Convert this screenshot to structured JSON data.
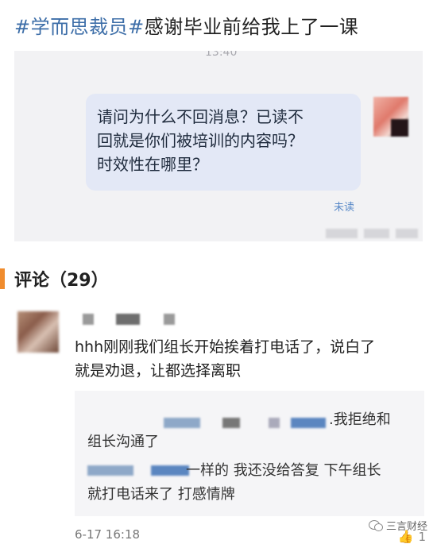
{
  "post": {
    "hashtag1": "#学而思裁员#",
    "title": "感谢毕业前给我上了一课"
  },
  "screenshot": {
    "time": "13:40",
    "message_lines": [
      "请问为什么不回消息？已读不",
      "回就是你们被培训的内容吗？",
      "时效性在哪里？"
    ],
    "status": "未读"
  },
  "comments": {
    "header": "评论（29）",
    "items": [
      {
        "text_lines": [
          "hhh刚刚我们组长开始挨着打电话了，说白了",
          "就是劝退，让都选择离职"
        ],
        "replies": [
          {
            "line1": ".我拒绝和",
            "line2": "组长沟通了"
          },
          {
            "line1": "一样的 我还没给答复 下午组长",
            "line2": "就打电话来了 打感情牌"
          }
        ],
        "date": "6-17 16:18",
        "likes": "1"
      }
    ]
  },
  "watermark": "三言财经",
  "colors": {
    "hashtag": "#3d6ea8",
    "accent": "#f08c2e",
    "bubble": "#e3e8f6",
    "status": "#5a8ac8"
  }
}
